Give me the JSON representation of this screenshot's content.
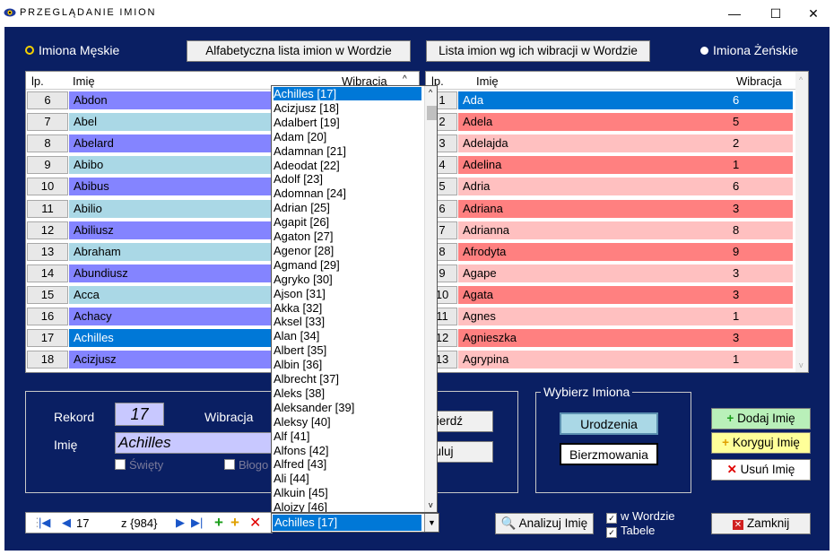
{
  "window": {
    "title": "PRZEGLĄDANIE IMION",
    "minimize_glyph": "—",
    "maximize_glyph": "☐",
    "close_glyph": "✕",
    "icon": "eye-icon"
  },
  "radio": {
    "male_label": "Imiona Męskie",
    "female_label": "Imiona Żeńskie"
  },
  "buttons": {
    "alpha_list": "Alfabetyczna lista imion w Wordzie",
    "vib_list": "Lista imion wg ich wibracji w Wordzie",
    "confirm": "wierdź",
    "cancel": "nuluj",
    "urodzenia": "Urodzenia",
    "bierzmowania": "Bierzmowania",
    "add": "Dodaj Imię",
    "edit": "Koryguj Imię",
    "delete": "Usuń Imię",
    "analyze": "Analizuj Imię",
    "close": "Zamknij"
  },
  "left_grid": {
    "headers": {
      "no": "lp.",
      "name": "Imię",
      "vib": "Wibracja"
    },
    "rows": [
      {
        "no": "6",
        "name": "Abdon"
      },
      {
        "no": "7",
        "name": "Abel"
      },
      {
        "no": "8",
        "name": "Abelard"
      },
      {
        "no": "9",
        "name": "Abibo"
      },
      {
        "no": "10",
        "name": "Abibus"
      },
      {
        "no": "11",
        "name": "Abilio"
      },
      {
        "no": "12",
        "name": "Abiliusz"
      },
      {
        "no": "13",
        "name": "Abraham"
      },
      {
        "no": "14",
        "name": "Abundiusz"
      },
      {
        "no": "15",
        "name": "Acca"
      },
      {
        "no": "16",
        "name": "Achacy"
      },
      {
        "no": "17",
        "name": "Achilles"
      },
      {
        "no": "18",
        "name": "Acizjusz"
      }
    ]
  },
  "right_grid": {
    "headers": {
      "no": "lp.",
      "name": "Imię",
      "vib": "Wibracja"
    },
    "rows": [
      {
        "no": "1",
        "name": "Ada",
        "vib": "6"
      },
      {
        "no": "2",
        "name": "Adela",
        "vib": "5"
      },
      {
        "no": "3",
        "name": "Adelajda",
        "vib": "2"
      },
      {
        "no": "4",
        "name": "Adelina",
        "vib": "1"
      },
      {
        "no": "5",
        "name": "Adria",
        "vib": "6"
      },
      {
        "no": "6",
        "name": "Adriana",
        "vib": "3"
      },
      {
        "no": "7",
        "name": "Adrianna",
        "vib": "8"
      },
      {
        "no": "8",
        "name": "Afrodyta",
        "vib": "9"
      },
      {
        "no": "9",
        "name": "Agape",
        "vib": "3"
      },
      {
        "no": "10",
        "name": "Agata",
        "vib": "3"
      },
      {
        "no": "11",
        "name": "Agnes",
        "vib": "1"
      },
      {
        "no": "12",
        "name": "Agnieszka",
        "vib": "3"
      },
      {
        "no": "13",
        "name": "Agrypina",
        "vib": "1"
      }
    ]
  },
  "dropdown_items": [
    "Achilles [17]",
    "Acizjusz [18]",
    "Adalbert [19]",
    "Adam [20]",
    "Adamnan [21]",
    "Adeodat [22]",
    "Adolf [23]",
    "Adomnan [24]",
    "Adrian [25]",
    "Agapit [26]",
    "Agaton [27]",
    "Agenor [28]",
    "Agmand [29]",
    "Agryko [30]",
    "Ajson [31]",
    "Akka [32]",
    "Aksel [33]",
    "Alan [34]",
    "Albert [35]",
    "Albin [36]",
    "Albrecht [37]",
    "Aleks [38]",
    "Aleksander [39]",
    "Aleksy [40]",
    "Alf [41]",
    "Alfons [42]",
    "Alfred [43]",
    "Ali [44]",
    "Alkuin [45]",
    "Alojzy [46]"
  ],
  "combo_value": "Achilles [17]",
  "record": {
    "rekord_label": "Rekord",
    "rekord_value": "17",
    "wibracja_label": "Wibracja",
    "imie_label": "Imię",
    "imie_value": "Achilles",
    "swiety_label": "Święty",
    "blogo_label": "Błogo"
  },
  "wybierz": {
    "title": "Wybierz Imiona"
  },
  "checks": {
    "word": "w Wordzie",
    "tables": "Tabele"
  },
  "nav": {
    "position": "17",
    "count": "z {984}"
  },
  "colors": {
    "background": "#0a1f63",
    "male_row_a": "#8484ff",
    "male_row_b": "#aad8e6",
    "female_row_a": "#ffc0c0",
    "female_row_b": "#ff8080",
    "selected": "#0078d7"
  }
}
